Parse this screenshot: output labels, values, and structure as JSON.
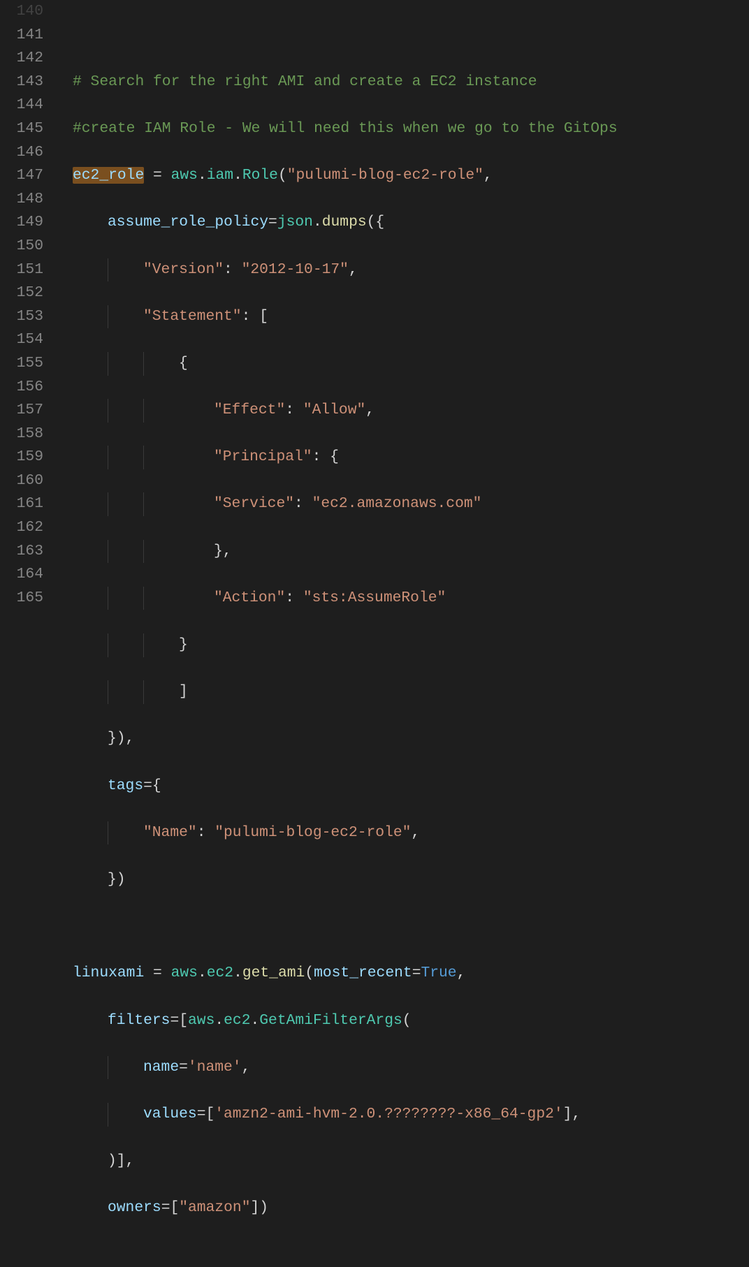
{
  "gutter": {
    "start": 140,
    "lines": [
      "140",
      "141",
      "142",
      "143",
      "144",
      "145",
      "146",
      "147",
      "148",
      "149",
      "150",
      "151",
      "152",
      "153",
      "154",
      "155",
      "156",
      "157",
      "158",
      "159",
      "160",
      "161",
      "162",
      "163",
      "164",
      "165"
    ]
  },
  "code": {
    "l141_comment": "# Search for the right AMI and create a EC2 instance",
    "l142_comment": "#create IAM Role - We will need this when we go to the GitOps",
    "l143_var": "ec2_role",
    "l143_eq": " = ",
    "l143_aws": "aws",
    "l143_dot1": ".",
    "l143_iam": "iam",
    "l143_dot2": ".",
    "l143_role": "Role",
    "l143_open": "(",
    "l143_str": "\"pulumi-blog-ec2-role\"",
    "l143_comma": ",",
    "l144_param": "assume_role_policy",
    "l144_eq": "=",
    "l144_json": "json",
    "l144_dot": ".",
    "l144_dumps": "dumps",
    "l144_open": "({",
    "l145_key": "\"Version\"",
    "l145_colon": ": ",
    "l145_val": "\"2012-10-17\"",
    "l145_comma": ",",
    "l146_key": "\"Statement\"",
    "l146_colon": ": [",
    "l147_brace": "{",
    "l148_key": "\"Effect\"",
    "l148_colon": ": ",
    "l148_val": "\"Allow\"",
    "l148_comma": ",",
    "l149_key": "\"Principal\"",
    "l149_colon": ": {",
    "l150_key": "\"Service\"",
    "l150_colon": ": ",
    "l150_val": "\"ec2.amazonaws.com\"",
    "l151_brace": "},",
    "l152_key": "\"Action\"",
    "l152_colon": ": ",
    "l152_val": "\"sts:AssumeRole\"",
    "l153_brace": "}",
    "l154_brace": "]",
    "l155_close": "}),",
    "l156_param": "tags",
    "l156_eq": "={",
    "l157_key": "\"Name\"",
    "l157_colon": ": ",
    "l157_val": "\"pulumi-blog-ec2-role\"",
    "l157_comma": ",",
    "l158_close": "})",
    "l160_var": "linuxami",
    "l160_eq": " = ",
    "l160_aws": "aws",
    "l160_dot1": ".",
    "l160_ec2": "ec2",
    "l160_dot2": ".",
    "l160_getami": "get_ami",
    "l160_open": "(",
    "l160_param": "most_recent",
    "l160_eq2": "=",
    "l160_true": "True",
    "l160_comma": ",",
    "l161_param": "filters",
    "l161_eq": "=[",
    "l161_aws": "aws",
    "l161_dot1": ".",
    "l161_ec2": "ec2",
    "l161_dot2": ".",
    "l161_cls": "GetAmiFilterArgs",
    "l161_open": "(",
    "l162_param": "name",
    "l162_eq": "=",
    "l162_val": "'name'",
    "l162_comma": ",",
    "l163_param": "values",
    "l163_eq": "=[",
    "l163_val": "'amzn2-ami-hvm-2.0.????????-x86_64-gp2'",
    "l163_close": "],",
    "l164_close": ")],",
    "l165_param": "owners",
    "l165_eq": "=[",
    "l165_val": "\"amazon\"",
    "l165_close": "])"
  }
}
